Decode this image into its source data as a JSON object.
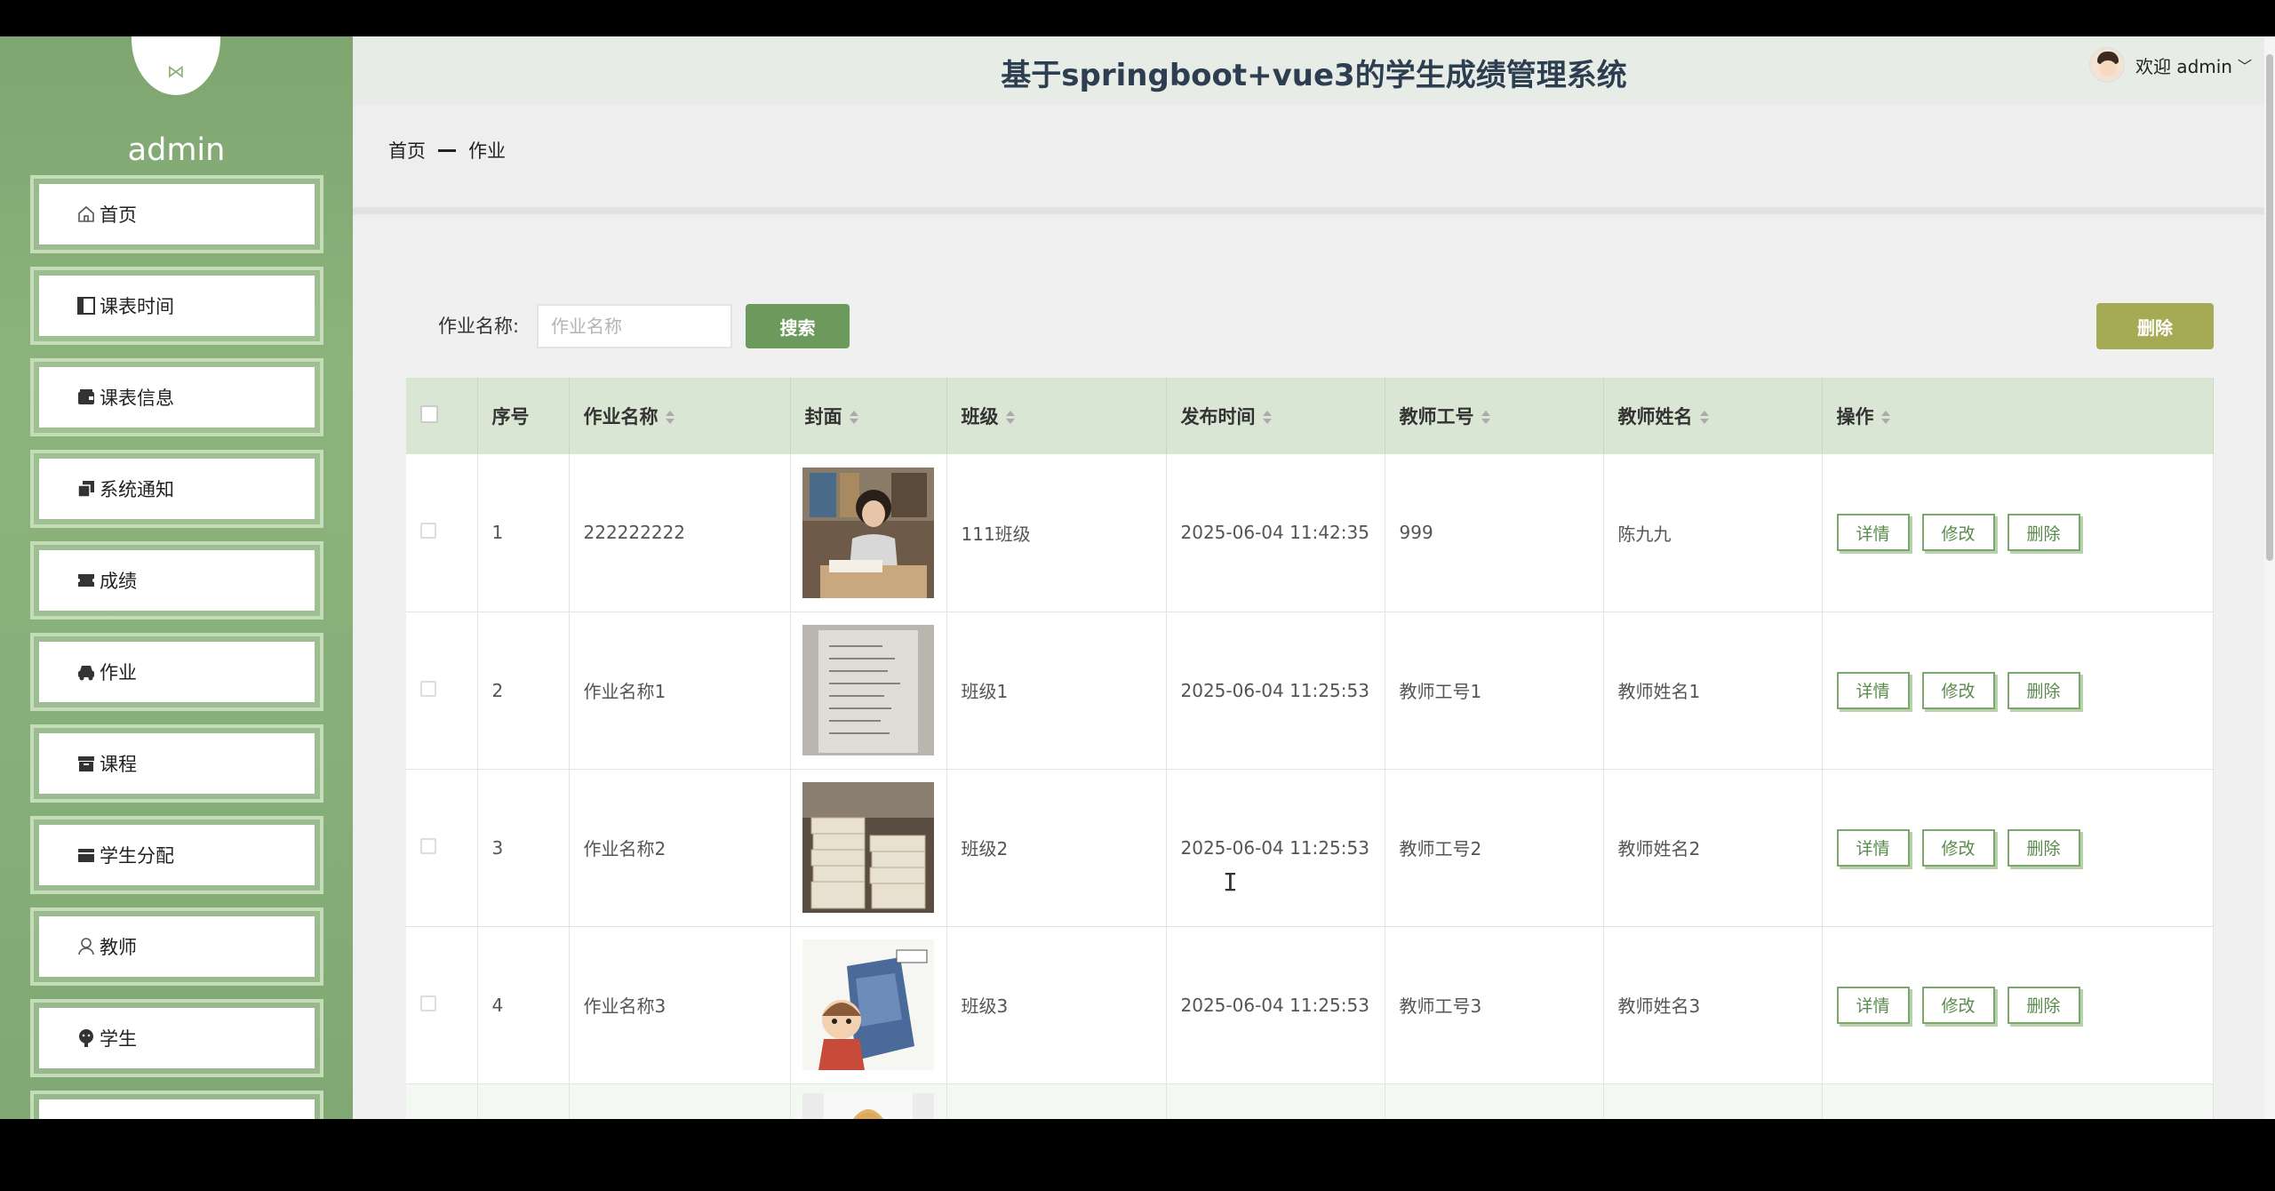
{
  "header": {
    "title": "基于springboot+vue3的学生成绩管理系统",
    "welcome": "欢迎 admin"
  },
  "sidebar": {
    "username": "admin",
    "items": [
      {
        "label": "首页",
        "icon": "home-icon"
      },
      {
        "label": "课表时间",
        "icon": "calendar-icon"
      },
      {
        "label": "课表信息",
        "icon": "wallet-icon"
      },
      {
        "label": "系统通知",
        "icon": "copy-icon"
      },
      {
        "label": "成绩",
        "icon": "ticket-icon"
      },
      {
        "label": "作业",
        "icon": "car-icon"
      },
      {
        "label": "课程",
        "icon": "box-icon"
      },
      {
        "label": "学生分配",
        "icon": "card-icon"
      },
      {
        "label": "教师",
        "icon": "user-icon"
      },
      {
        "label": "学生",
        "icon": "avatar-icon"
      }
    ]
  },
  "breadcrumb": {
    "home": "首页",
    "current": "作业"
  },
  "search": {
    "label": "作业名称:",
    "placeholder": "作业名称",
    "button": "搜索",
    "bulk_delete": "删除"
  },
  "table": {
    "headers": {
      "index": "序号",
      "name": "作业名称",
      "cover": "封面",
      "class": "班级",
      "time": "发布时间",
      "teacher_id": "教师工号",
      "teacher_name": "教师姓名",
      "actions": "操作"
    },
    "actions": {
      "detail": "详情",
      "edit": "修改",
      "delete": "删除"
    },
    "rows": [
      {
        "index": "1",
        "name": "222222222",
        "class": "111班级",
        "time": "2025-06-04 11:42:35",
        "teacher_id": "999",
        "teacher_name": "陈九九"
      },
      {
        "index": "2",
        "name": "作业名称1",
        "class": "班级1",
        "time": "2025-06-04 11:25:53",
        "teacher_id": "教师工号1",
        "teacher_name": "教师姓名1"
      },
      {
        "index": "3",
        "name": "作业名称2",
        "class": "班级2",
        "time": "2025-06-04 11:25:53",
        "teacher_id": "教师工号2",
        "teacher_name": "教师姓名2"
      },
      {
        "index": "4",
        "name": "作业名称3",
        "class": "班级3",
        "time": "2025-06-04 11:25:53",
        "teacher_id": "教师工号3",
        "teacher_name": "教师姓名3"
      },
      {
        "index": "",
        "name": "",
        "class": "",
        "time": "",
        "teacher_id": "",
        "teacher_name": ""
      }
    ]
  },
  "colors": {
    "sidebar": "#88b07a",
    "primary": "#6b9a5c",
    "warning": "#a5ab55",
    "header_row": "#d9e6d3"
  }
}
